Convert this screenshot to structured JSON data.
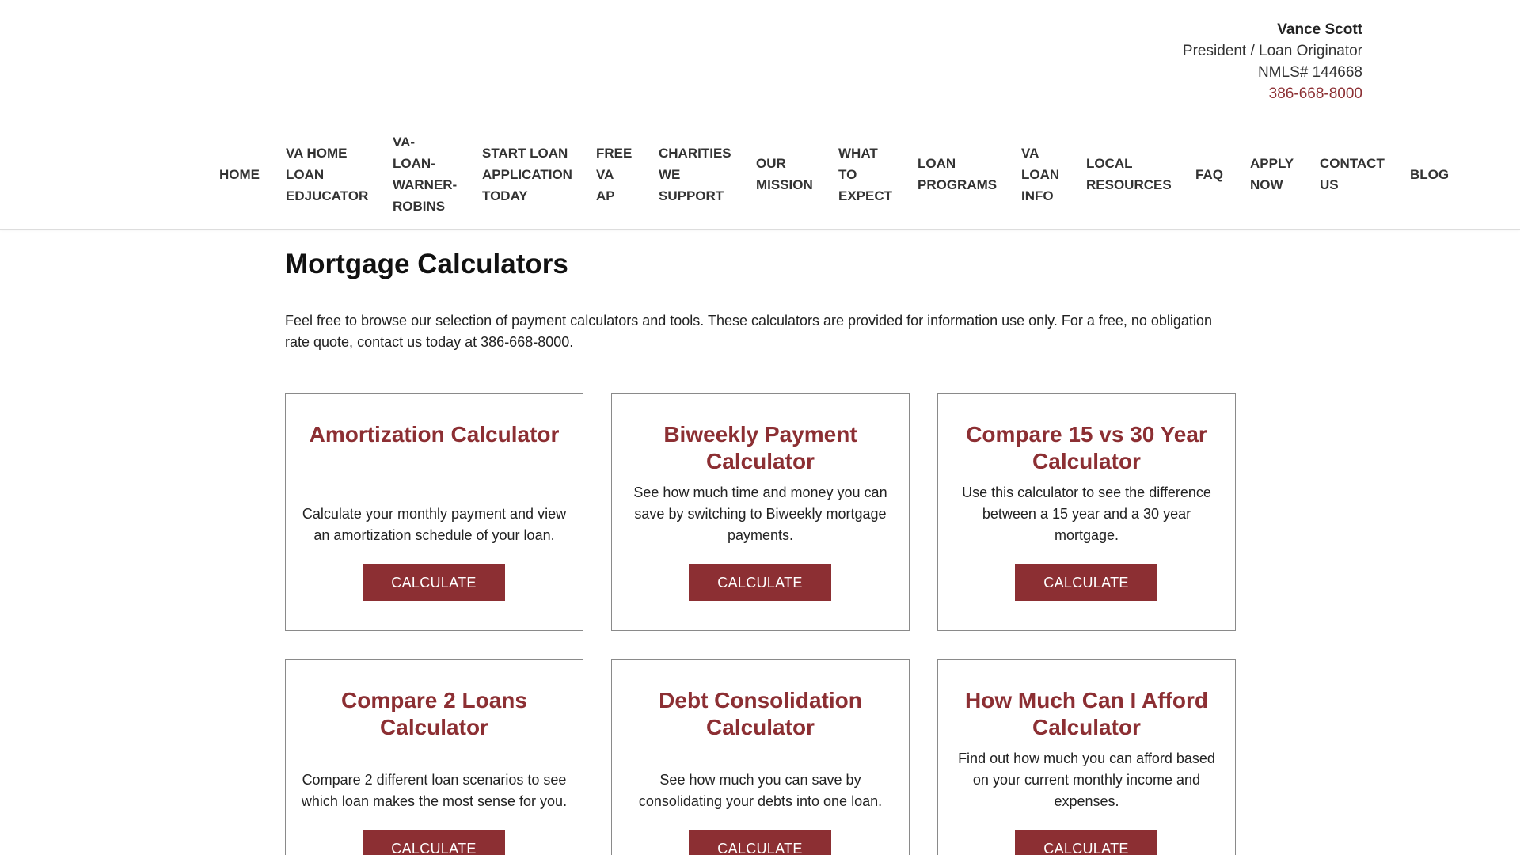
{
  "contact": {
    "name": "Vance Scott",
    "title": "President / Loan Originator",
    "nmls": "NMLS# 144668",
    "phone": "386-668-8000"
  },
  "nav": {
    "items": [
      {
        "lines": [
          "HOME"
        ]
      },
      {
        "lines": [
          "VA HOME",
          "LOAN",
          "EDJUCATOR"
        ]
      },
      {
        "lines": [
          "VA-",
          "LOAN-",
          "WARNER-",
          "ROBINS"
        ]
      },
      {
        "lines": [
          "START LOAN",
          "APPLICATION",
          "TODAY"
        ]
      },
      {
        "lines": [
          "FREE",
          "VA",
          "AP"
        ]
      },
      {
        "lines": [
          "CHARITIES",
          "WE",
          "SUPPORT"
        ]
      },
      {
        "lines": [
          "OUR",
          "MISSION"
        ]
      },
      {
        "lines": [
          "WHAT",
          "TO",
          "EXPECT"
        ]
      },
      {
        "lines": [
          "LOAN",
          "PROGRAMS"
        ]
      },
      {
        "lines": [
          "VA",
          "LOAN",
          "INFO"
        ]
      },
      {
        "lines": [
          "LOCAL",
          "RESOURCES"
        ]
      },
      {
        "lines": [
          "FAQ"
        ]
      },
      {
        "lines": [
          "APPLY",
          "NOW"
        ]
      },
      {
        "lines": [
          "CONTACT",
          "US"
        ]
      },
      {
        "lines": [
          "BLOG"
        ]
      }
    ]
  },
  "main": {
    "title": "Mortgage Calculators",
    "intro": "Feel free to browse our selection of payment calculators and tools. These calculators are provided for information use only. For a free, no obligation rate quote, contact us today at 386-668-8000."
  },
  "cards": [
    {
      "title": "Amortization Calculator",
      "desc": "Calculate your monthly payment and view an amortization schedule of your loan.",
      "button": "CALCULATE"
    },
    {
      "title": "Biweekly Payment Calculator",
      "desc": "See how much time and money you can save by switching to Biweekly mortgage payments.",
      "button": "CALCULATE"
    },
    {
      "title": "Compare 15 vs 30 Year Calculator",
      "desc": "Use this calculator to see the difference between a 15 year and a 30 year mortgage.",
      "button": "CALCULATE"
    },
    {
      "title": "Compare 2 Loans Calculator",
      "desc": "Compare 2 different loan scenarios to see which loan makes the most sense for you.",
      "button": "CALCULATE"
    },
    {
      "title": "Debt Consolidation Calculator",
      "desc": "See how much you can save by consolidating your debts into one loan.",
      "button": "CALCULATE"
    },
    {
      "title": "How Much Can I Afford Calculator",
      "desc": "Find out how much you can afford based on your current monthly income and expenses.",
      "button": "CALCULATE"
    }
  ],
  "colors": {
    "accent": "#8c2f33",
    "text": "#222222",
    "border": "#8a8a8a"
  }
}
